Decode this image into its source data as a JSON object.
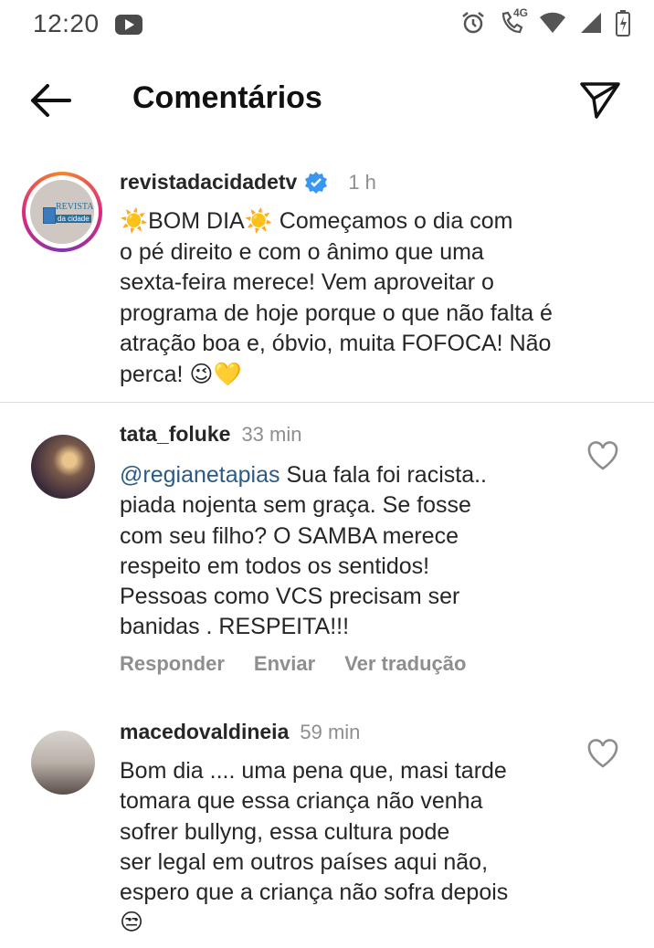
{
  "status_bar": {
    "time": "12:20",
    "icons": [
      "youtube-icon",
      "alarm-icon",
      "volte-call-icon",
      "wifi-icon",
      "signal-icon",
      "battery-charging-icon"
    ],
    "network": "4G"
  },
  "header": {
    "title": "Comentários",
    "back_icon": "arrow-left-icon",
    "send_icon": "paper-plane-icon"
  },
  "post": {
    "username": "revistadacidadetv",
    "verified": true,
    "time": "1 h",
    "avatar_logo_line1": "REVISTA",
    "avatar_logo_line2": "da cidade",
    "text_line1": "☀️BOM DIA☀️ Começamos o dia com",
    "text_line2": "o pé direito e com o ânimo que uma",
    "text_line3": "sexta-feira merece! Vem aproveitar o",
    "text_line4": "programa de hoje porque o que não falta é",
    "text_line5": "atração boa e, óbvio, muita FOFOCA! Não",
    "text_line6": "perca! 😉💛"
  },
  "comments": [
    {
      "username": "tata_foluke",
      "time": "33 min",
      "mention": "@regianetapias",
      "line1_rest": " Sua fala foi racista..",
      "line2": "piada nojenta sem graça. Se fosse",
      "line3": "com seu filho?  O SAMBA merece",
      "line4": "respeito em todos os sentidos!",
      "line5": "Pessoas como VCS precisam ser",
      "line6": "banidas   . RESPEITA!!!",
      "actions": [
        "Responder",
        "Enviar",
        "Ver tradução"
      ]
    },
    {
      "username": "macedovaldineia",
      "time": "59 min",
      "line1": "Bom dia .... uma pena que, masi tarde",
      "line2": "tomara que essa criança não venha",
      "line3": "sofrer bullyng, essa cultura pode",
      "line4": "ser legal em outros países aqui não,",
      "line5": "espero que a criança não sofra depois",
      "line6": "😒"
    }
  ]
}
